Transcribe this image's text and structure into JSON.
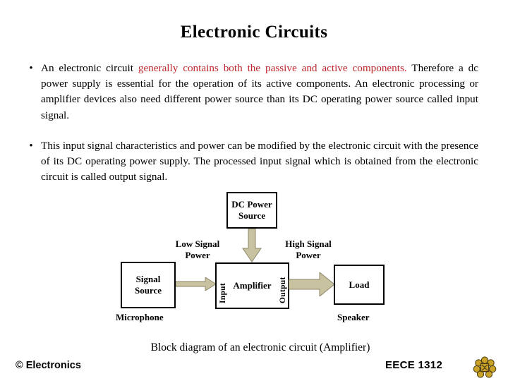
{
  "slide": {
    "title": "Electronic Circuits",
    "bullets": [
      {
        "marker": "•",
        "segments": [
          {
            "text": "An electronic circuit ",
            "style": "normal"
          },
          {
            "text": "generally contains both the passive and active components.",
            "style": "red"
          },
          {
            "text": " Therefore a dc power supply is essential for the operation of its active components. An electronic processing or amplifier devices also need different power source than its DC operating power source called input signal.",
            "style": "normal"
          }
        ]
      },
      {
        "marker": "•",
        "segments": [
          {
            "text": "This input signal characteristics and power can be modified by the electronic circuit with the presence of its DC operating power supply. The processed input signal which is obtained from the electronic circuit is called output signal.",
            "style": "normal"
          }
        ]
      }
    ],
    "caption": "Block diagram of an electronic circuit (Amplifier)"
  },
  "diagram": {
    "blocks": {
      "dc_power": {
        "line1": "DC  Power",
        "line2": "Source"
      },
      "signal_source": {
        "line1": "Signal",
        "line2": "Source"
      },
      "amplifier": {
        "line1": "Amplifier"
      },
      "load": {
        "line1": "Load"
      }
    },
    "port_labels": {
      "input": "Input",
      "output": "Output"
    },
    "flow_labels": {
      "low_signal": "Low Signal",
      "low_signal_2": "Power",
      "high_signal": "High Signal",
      "high_signal_2": "Power"
    },
    "device_labels": {
      "microphone": "Microphone",
      "speaker": "Speaker"
    },
    "colors": {
      "arrow_fill": "#C9C2A0",
      "arrow_stroke": "#8C866A",
      "box_border": "#000000"
    }
  },
  "footer": {
    "left": "© Electronics",
    "course": "EECE 1312"
  },
  "theme": {
    "background": "#FFFFFF",
    "text": "#000000",
    "highlight_red": "#BF262C",
    "logo_gold": "#C9A227",
    "logo_dark": "#4A3B12"
  }
}
